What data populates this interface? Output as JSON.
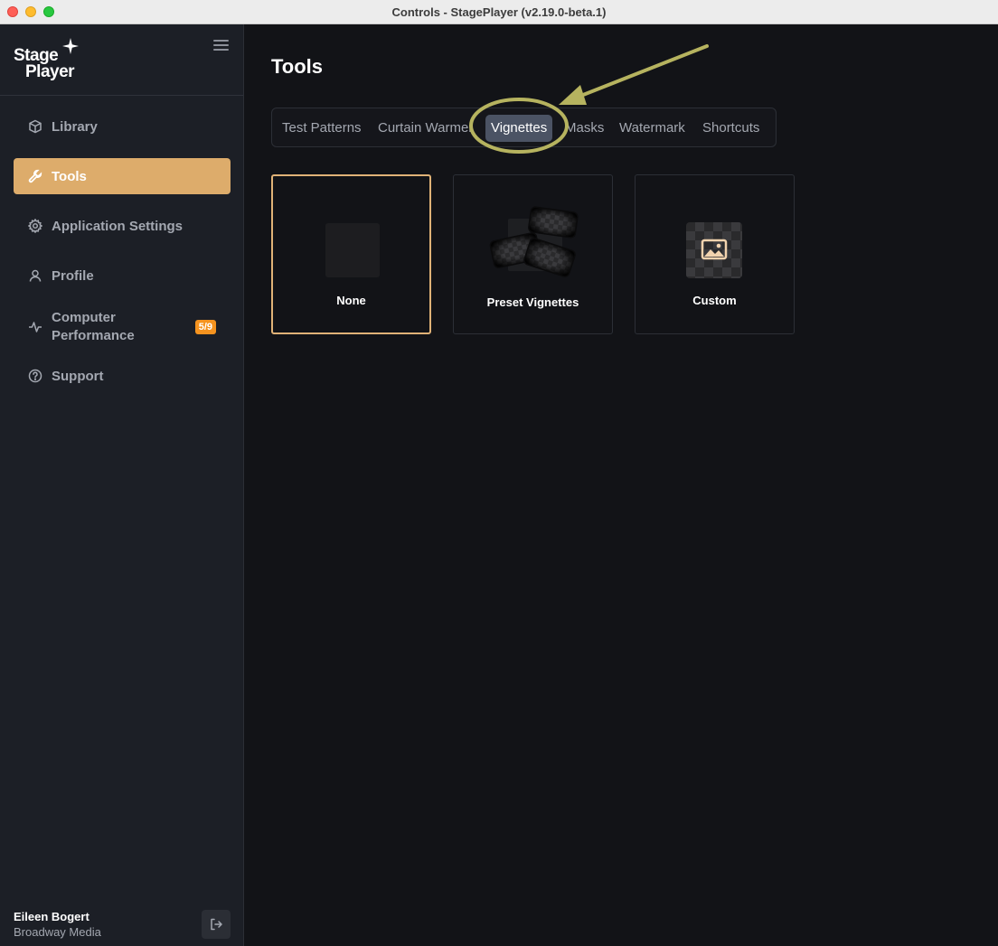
{
  "window": {
    "title": "Controls - StagePlayer (v2.19.0-beta.1)"
  },
  "sidebar": {
    "logo": {
      "line1": "Stage",
      "line2": "Player"
    },
    "items": [
      {
        "label": "Library",
        "icon": "cube-icon",
        "active": false
      },
      {
        "label": "Tools",
        "icon": "wrench-icon",
        "active": true
      },
      {
        "label": "Application Settings",
        "icon": "gear-icon",
        "active": false
      },
      {
        "label": "Profile",
        "icon": "user-icon",
        "active": false
      },
      {
        "label_line1": "Computer",
        "label_line2": "Performance",
        "icon": "pulse-icon",
        "badge": "5/9",
        "active": false
      },
      {
        "label": "Support",
        "icon": "help-circle-icon",
        "active": false
      }
    ],
    "user": {
      "name": "Eileen Bogert",
      "org": "Broadway Media"
    }
  },
  "main": {
    "title": "Tools",
    "tabs": [
      {
        "label": "Test Patterns",
        "active": false
      },
      {
        "label": "Curtain Warmer",
        "active": false
      },
      {
        "label": "Vignettes",
        "active": true
      },
      {
        "label": "Masks",
        "active": false
      },
      {
        "label": "Watermark",
        "active": false
      },
      {
        "label": "Shortcuts",
        "active": false
      }
    ],
    "cards": [
      {
        "label": "None",
        "selected": true
      },
      {
        "label": "Preset Vignettes",
        "selected": false
      },
      {
        "label": "Custom",
        "selected": false
      }
    ]
  },
  "colors": {
    "accent": "#ddac6b",
    "badge": "#f5931f",
    "annotation": "#b6b35f"
  }
}
